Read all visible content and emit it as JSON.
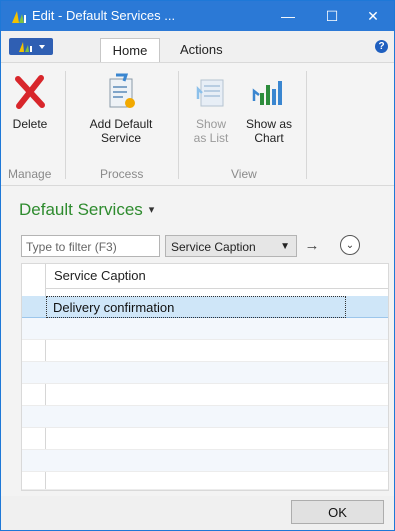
{
  "window": {
    "title": "Edit - Default Services ...",
    "minimize": "—",
    "maximize": "☐",
    "close": "✕",
    "accent_color": "#2b79d6"
  },
  "ribbon": {
    "tabs": [
      {
        "label": "Home",
        "active": true
      },
      {
        "label": "Actions",
        "active": false
      }
    ],
    "help_symbol": "?",
    "buttons": {
      "delete": {
        "label": "Delete",
        "icon": "red-x-icon"
      },
      "add_default_service": {
        "label_line1": "Add Default",
        "label_line2": "Service",
        "icon": "document-add-icon"
      },
      "show_as_list": {
        "label_line1": "Show",
        "label_line2": "as List",
        "icon": "list-icon",
        "disabled": true
      },
      "show_as_chart": {
        "label_line1": "Show as",
        "label_line2": "Chart",
        "icon": "chart-icon",
        "disabled": false
      }
    },
    "groups": {
      "manage": "Manage",
      "process": "Process",
      "view": "View"
    }
  },
  "page": {
    "title": "Default Services",
    "title_caret": "▾",
    "title_color": "#2e8b2e"
  },
  "filter": {
    "placeholder": "Type to filter (F3)",
    "field": "Service Caption",
    "field_dropdown": "▼",
    "go_symbol": "→",
    "expand_symbol": "⌄"
  },
  "grid": {
    "column_header": "Service Caption",
    "rows": [
      {
        "service_caption": "Delivery confirmation",
        "selected": true
      }
    ],
    "selected_color": "#cfe6f8"
  },
  "footer": {
    "ok_label": "OK"
  }
}
